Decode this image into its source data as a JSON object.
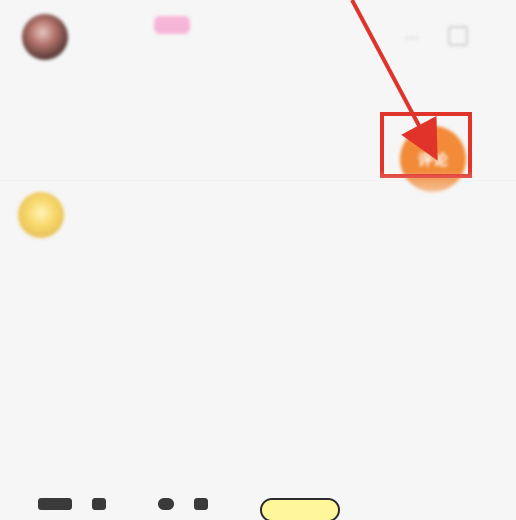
{
  "comment_1": {
    "username": "",
    "badge": "",
    "meta": "",
    "lines": [
      "",
      "",
      ""
    ]
  },
  "comment_2": {
    "username": ""
  },
  "fab": {
    "label": "评论"
  },
  "colors": {
    "annotation_red": "#e0342b",
    "fab_orange": "#f28a37",
    "badge_pink": "#f6b6d8"
  }
}
